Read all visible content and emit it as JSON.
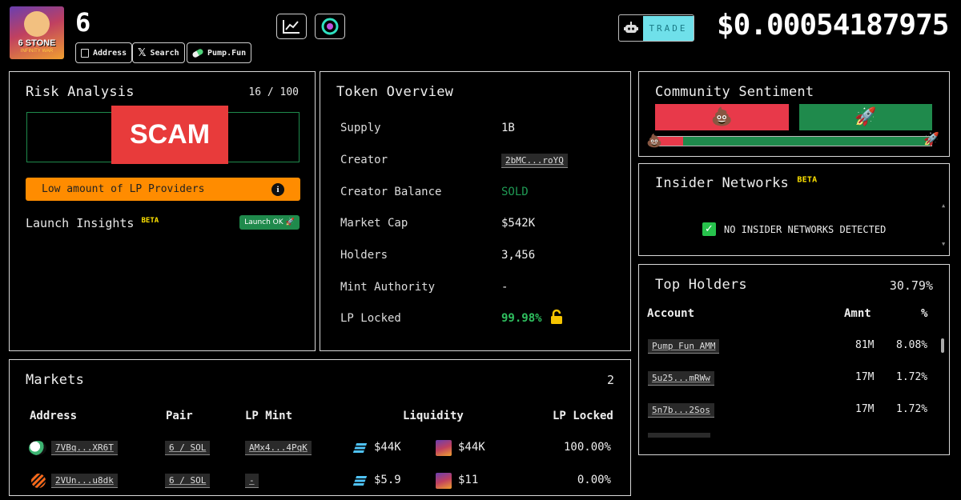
{
  "header": {
    "token_symbol": "6",
    "logo_text": "6 STONE",
    "logo_subtext": "INFINITY WAR",
    "buttons": {
      "address": "Address",
      "search": "Search",
      "pumpfun": "Pump.Fun"
    },
    "chart_button_icon": "chart-line-icon",
    "alt_button_icon": "circle-logo-icon",
    "trade_label": "TRADE",
    "price": "$0.00054187975"
  },
  "risk": {
    "title": "Risk Analysis",
    "score": "16 / 100",
    "verdict": "SCAM",
    "warning": "Low amount of LP Providers",
    "launch_label": "Launch Insights",
    "beta": "BETA",
    "launch_badge": "Launch OK 🚀",
    "colors": {
      "danger": "#e83b3b",
      "warning": "#ff8c00",
      "ok": "#1f8a4c"
    }
  },
  "overview": {
    "title": "Token Overview",
    "rows": [
      {
        "label": "Supply",
        "value": "1B"
      },
      {
        "label": "Creator",
        "value": "2bMC...roYQ"
      },
      {
        "label": "Creator Balance",
        "value": "SOLD"
      },
      {
        "label": "Market Cap",
        "value": "$542K"
      },
      {
        "label": "Holders",
        "value": "3,456"
      },
      {
        "label": "Mint Authority",
        "value": "-"
      },
      {
        "label": "LP Locked",
        "value": "99.98%"
      }
    ]
  },
  "sentiment": {
    "title": "Community Sentiment",
    "bad_emoji": "💩",
    "good_emoji": "🚀",
    "bad_fraction": 0.1
  },
  "insider": {
    "title": "Insider Networks",
    "beta": "BETA",
    "status": "NO INSIDER NETWORKS DETECTED"
  },
  "holders": {
    "title": "Top Holders",
    "total": "30.79%",
    "headers": {
      "account": "Account",
      "amount": "Amnt",
      "pct": "%"
    },
    "rows": [
      {
        "account": "Pump Fun AMM",
        "amount": "81M",
        "pct": "8.08%"
      },
      {
        "account": "5u25...mRWw",
        "amount": "17M",
        "pct": "1.72%"
      },
      {
        "account": "5n7b...2Sos",
        "amount": "17M",
        "pct": "1.72%"
      }
    ]
  },
  "markets": {
    "title": "Markets",
    "count": "2",
    "headers": {
      "address": "Address",
      "pair": "Pair",
      "lp_mint": "LP Mint",
      "liquidity": "Liquidity",
      "lp_locked": "LP Locked"
    },
    "rows": [
      {
        "address": "7VBq...XR6T",
        "pair": "6 / SOL",
        "lp_mint": "AMx4...4PqK",
        "liq_sol": "$44K",
        "liq_token": "$44K",
        "lp_locked": "100.00%"
      },
      {
        "address": "2VUn...u8dk",
        "pair": "6 / SOL",
        "lp_mint": "-",
        "liq_sol": "$5.9",
        "liq_token": "$11",
        "lp_locked": "0.00%"
      }
    ]
  }
}
